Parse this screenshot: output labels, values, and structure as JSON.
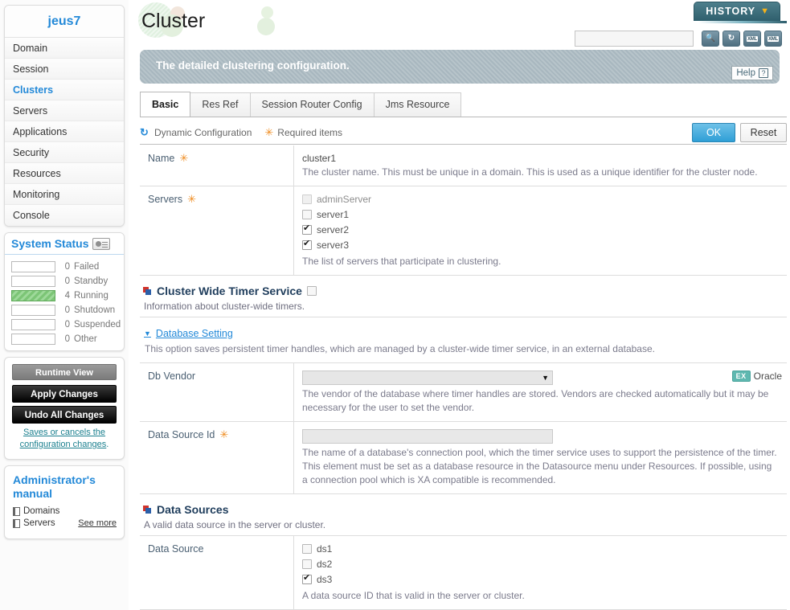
{
  "sidebar": {
    "brand": "jeus7",
    "nav_items": [
      {
        "label": "Domain",
        "active": false
      },
      {
        "label": "Session",
        "active": false
      },
      {
        "label": "Clusters",
        "active": true
      },
      {
        "label": "Servers",
        "active": false
      },
      {
        "label": "Applications",
        "active": false
      },
      {
        "label": "Security",
        "active": false
      },
      {
        "label": "Resources",
        "active": false
      },
      {
        "label": "Monitoring",
        "active": false
      },
      {
        "label": "Console",
        "active": false
      }
    ],
    "system_status": {
      "title": "System Status",
      "icon": "monitor-chart-icon",
      "rows": [
        {
          "count": "0",
          "label": "Failed",
          "filled": false
        },
        {
          "count": "0",
          "label": "Standby",
          "filled": false
        },
        {
          "count": "4",
          "label": "Running",
          "filled": true
        },
        {
          "count": "0",
          "label": "Shutdown",
          "filled": false
        },
        {
          "count": "0",
          "label": "Suspended",
          "filled": false
        },
        {
          "count": "0",
          "label": "Other",
          "filled": false
        }
      ]
    },
    "actions": {
      "runtime_view": "Runtime View",
      "apply_changes": "Apply Changes",
      "undo_all_changes": "Undo All Changes",
      "hint_link": "Saves or cancels the configuration changes",
      "hint_tail": "."
    },
    "manual": {
      "title": "Administrator's manual",
      "links": [
        "Domains",
        "Servers"
      ],
      "see_more": "See more"
    }
  },
  "header": {
    "page_title": "Cluster",
    "history_label": "HISTORY",
    "history_caret": "▼",
    "search_value": "",
    "search_placeholder": "",
    "tools": [
      {
        "name": "search-icon",
        "glyph": "🔍"
      },
      {
        "name": "refresh-icon",
        "glyph": "⟳"
      },
      {
        "name": "xml-import-icon",
        "glyph": "▲"
      },
      {
        "name": "xml-export-icon",
        "glyph": "▼"
      }
    ],
    "xml_chip": "XML",
    "banner_text": "The detailed clustering configuration.",
    "help_label": "Help",
    "help_mark": "?"
  },
  "tabs": [
    {
      "label": "Basic",
      "active": true
    },
    {
      "label": "Res Ref",
      "active": false
    },
    {
      "label": "Session Router Config",
      "active": false
    },
    {
      "label": "Jms Resource",
      "active": false
    }
  ],
  "legend": {
    "dynamic_icon": "↻",
    "dynamic_label": "Dynamic Configuration",
    "required_icon": "✳",
    "required_label": "Required items",
    "ok_label": "OK",
    "reset_label": "Reset"
  },
  "form": {
    "name_row": {
      "label": "Name",
      "required": "✳",
      "value": "cluster1",
      "desc": "The cluster name. This must be unique in a domain. This is used as a unique identifier for the cluster node."
    },
    "servers_row": {
      "label": "Servers",
      "required": "✳",
      "options": [
        {
          "label": "adminServer",
          "checked": false,
          "disabled": true
        },
        {
          "label": "server1",
          "checked": false,
          "disabled": false
        },
        {
          "label": "server2",
          "checked": true,
          "disabled": false
        },
        {
          "label": "server3",
          "checked": true,
          "disabled": false
        }
      ],
      "desc": "The list of servers that participate in clustering."
    }
  },
  "timer_section": {
    "title": "Cluster Wide Timer Service",
    "checkbox_checked": false,
    "desc": "Information about cluster-wide timers.",
    "database_setting": {
      "caret": "▼",
      "link": "Database Setting",
      "desc": "This option saves persistent timer handles, which are managed by a cluster-wide timer service, in an external database."
    },
    "db_vendor": {
      "label": "Db Vendor",
      "value": "",
      "caret": "▼",
      "vendor_chip": "EX",
      "vendor_name": "Oracle",
      "desc": "The vendor of the database where timer handles are stored. Vendors are checked automatically but it may be necessary for the user to set the vendor."
    },
    "data_source_id": {
      "label": "Data Source Id",
      "required": "✳",
      "value": "",
      "desc": "The name of a database's connection pool, which the timer service uses to support the persistence of the timer. This element must be set as a database resource in the Datasource menu under Resources. If possible, using a connection pool which is XA compatible is recommended."
    }
  },
  "data_sources_section": {
    "title": "Data Sources",
    "desc": "A valid data source in the server or cluster.",
    "row": {
      "label": "Data Source",
      "options": [
        {
          "label": "ds1",
          "checked": false
        },
        {
          "label": "ds2",
          "checked": false
        },
        {
          "label": "ds3",
          "checked": true
        }
      ],
      "desc": "A data source ID that is valid in the server or cluster."
    }
  }
}
